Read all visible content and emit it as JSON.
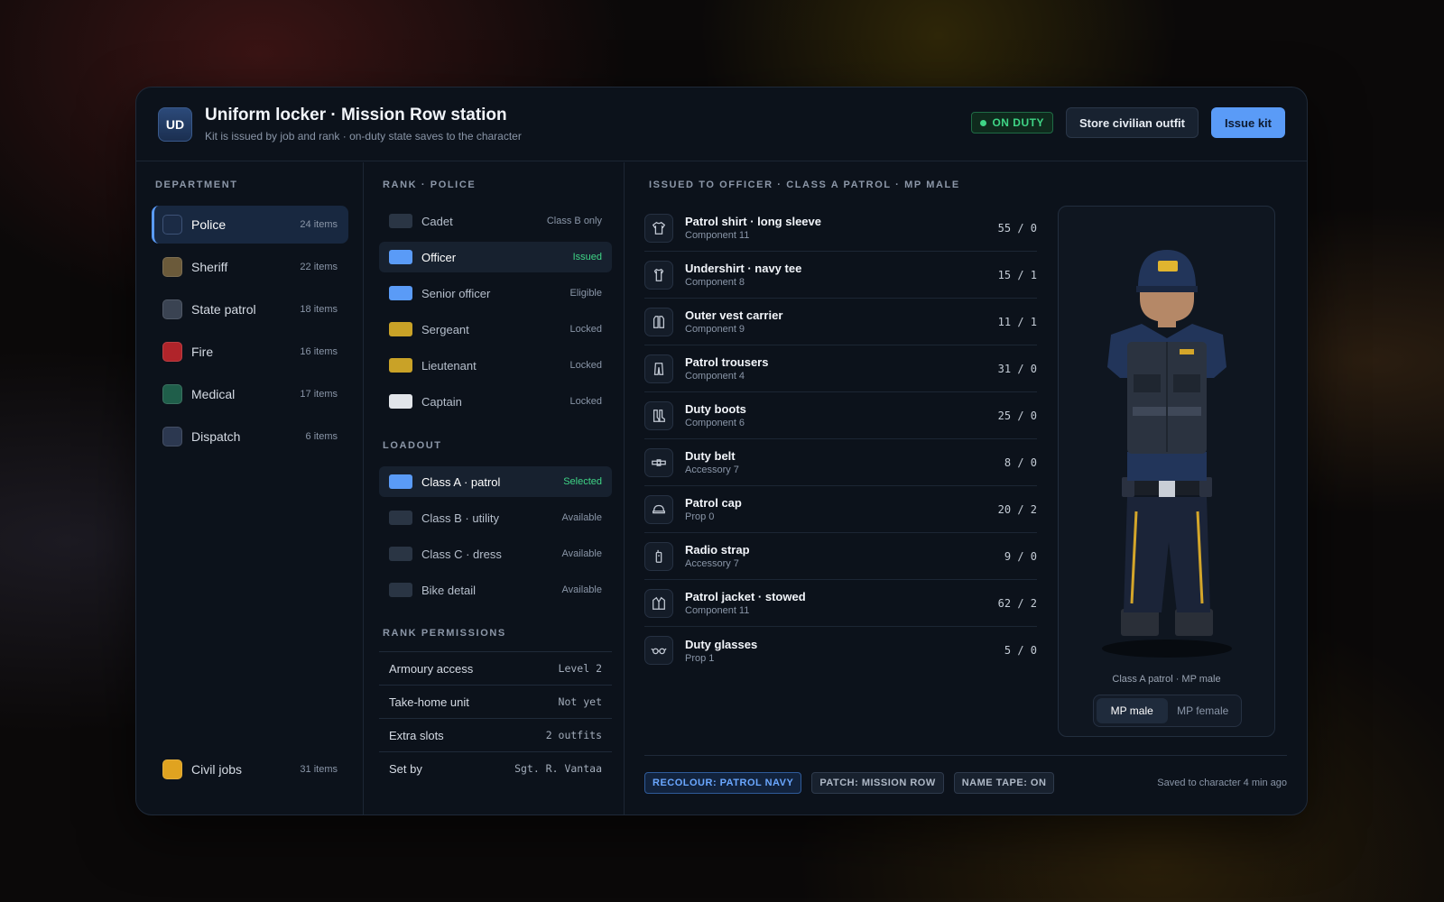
{
  "header": {
    "logo": "UD",
    "title": "Uniform locker · Mission Row station",
    "subtitle": "Kit is issued by job and rank · on-duty state saves to the character",
    "duty_badge": "ON DUTY",
    "store_button": "Store civilian outfit",
    "issue_button": "Issue kit"
  },
  "department": {
    "heading": "DEPARTMENT",
    "items": [
      {
        "name": "Police",
        "count": "24 items",
        "color": "#1b2b45"
      },
      {
        "name": "Sheriff",
        "count": "22 items",
        "color": "#6b5a3a"
      },
      {
        "name": "State patrol",
        "count": "18 items",
        "color": "#3a4352"
      },
      {
        "name": "Fire",
        "count": "16 items",
        "color": "#b0242a"
      },
      {
        "name": "Medical",
        "count": "17 items",
        "color": "#1f5e4a"
      },
      {
        "name": "Dispatch",
        "count": "6 items",
        "color": "#2c3850"
      }
    ],
    "civil": {
      "name": "Civil jobs",
      "count": "31 items",
      "color": "#e0a320"
    }
  },
  "rank": {
    "heading": "RANK · POLICE",
    "items": [
      {
        "name": "Cadet",
        "status": "Class B only",
        "color": "#2a3544"
      },
      {
        "name": "Officer",
        "status": "Issued",
        "color": "#5a9bf7"
      },
      {
        "name": "Senior officer",
        "status": "Eligible",
        "color": "#5a9bf7"
      },
      {
        "name": "Sergeant",
        "status": "Locked",
        "color": "#c9a227"
      },
      {
        "name": "Lieutenant",
        "status": "Locked",
        "color": "#c9a227"
      },
      {
        "name": "Captain",
        "status": "Locked",
        "color": "#e2e5ea"
      }
    ]
  },
  "loadout": {
    "heading": "LOADOUT",
    "items": [
      {
        "name": "Class A · patrol",
        "status": "Selected",
        "color": "#5a9bf7"
      },
      {
        "name": "Class B · utility",
        "status": "Available",
        "color": "#2a3544"
      },
      {
        "name": "Class C · dress",
        "status": "Available",
        "color": "#2a3544"
      },
      {
        "name": "Bike detail",
        "status": "Available",
        "color": "#2a3544"
      }
    ]
  },
  "permissions": {
    "heading": "RANK PERMISSIONS",
    "items": [
      {
        "name": "Armoury access",
        "value": "Level 2"
      },
      {
        "name": "Take-home unit",
        "value": "Not yet"
      },
      {
        "name": "Extra slots",
        "value": "2 outfits"
      },
      {
        "name": "Set by",
        "value": "Sgt. R. Vantaa"
      }
    ]
  },
  "issued": {
    "heading": "ISSUED TO OFFICER · CLASS A PATROL · MP MALE",
    "items": [
      {
        "name": "Patrol shirt · long sleeve",
        "sub": "Component 11",
        "value": "55 / 0",
        "icon": "shirt-icon"
      },
      {
        "name": "Undershirt · navy tee",
        "sub": "Component 8",
        "value": "15 / 1",
        "icon": "tee-icon"
      },
      {
        "name": "Outer vest carrier",
        "sub": "Component 9",
        "value": "11 / 1",
        "icon": "vest-icon"
      },
      {
        "name": "Patrol trousers",
        "sub": "Component 4",
        "value": "31 / 0",
        "icon": "trousers-icon"
      },
      {
        "name": "Duty boots",
        "sub": "Component 6",
        "value": "25 / 0",
        "icon": "boots-icon"
      },
      {
        "name": "Duty belt",
        "sub": "Accessory 7",
        "value": "8 / 0",
        "icon": "belt-icon"
      },
      {
        "name": "Patrol cap",
        "sub": "Prop 0",
        "value": "20 / 2",
        "icon": "cap-icon"
      },
      {
        "name": "Radio strap",
        "sub": "Accessory 7",
        "value": "9 / 0",
        "icon": "radio-icon"
      },
      {
        "name": "Patrol jacket · stowed",
        "sub": "Component 11",
        "value": "62 / 2",
        "icon": "jacket-icon"
      },
      {
        "name": "Duty glasses",
        "sub": "Prop 1",
        "value": "5 / 0",
        "icon": "glasses-icon"
      }
    ]
  },
  "preview": {
    "caption": "Class A patrol · MP male",
    "toggle": [
      "MP male",
      "MP female"
    ]
  },
  "footer": {
    "tags": [
      "RECOLOUR: PATROL NAVY",
      "PATCH: MISSION ROW",
      "NAME TAPE: ON"
    ],
    "saved": "Saved to character 4 min ago"
  }
}
